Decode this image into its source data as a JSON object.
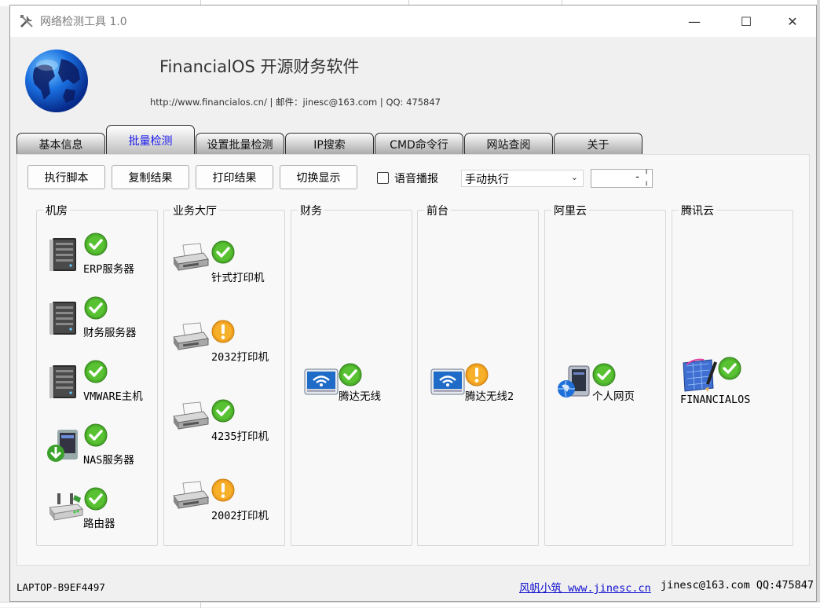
{
  "window": {
    "title": "网络检测工具 1.0",
    "controls": {
      "minimize": "—",
      "maximize": "☐",
      "close": "✕"
    }
  },
  "header": {
    "app_name": "FinancialOS 开源财务软件",
    "contact": "http://www.financialos.cn/ | 邮件：jinesc@163.com | QQ: 475847"
  },
  "tabs": [
    {
      "label": "基本信息",
      "active": false
    },
    {
      "label": "批量检测",
      "active": true
    },
    {
      "label": "设置批量检测",
      "active": false
    },
    {
      "label": "IP搜索",
      "active": false
    },
    {
      "label": "CMD命令行",
      "active": false
    },
    {
      "label": "网站查阅",
      "active": false
    },
    {
      "label": "关于",
      "active": false
    }
  ],
  "toolbar": {
    "run_label": "执行脚本",
    "copy_label": "复制结果",
    "print_label": "打印结果",
    "toggle_label": "切换显示",
    "voice_label": "语音播报",
    "voice_checked": false,
    "mode_value": "手动执行",
    "spin_value": "-"
  },
  "groups": [
    {
      "title": "机房",
      "devices": [
        {
          "label": "ERP服务器",
          "icon": "server-icon",
          "status": "ok"
        },
        {
          "label": "财务服务器",
          "icon": "server-icon",
          "status": "ok"
        },
        {
          "label": "VMWARE主机",
          "icon": "server-icon",
          "status": "ok"
        },
        {
          "label": "NAS服务器",
          "icon": "nas-server-icon",
          "status": "ok"
        },
        {
          "label": "路由器",
          "icon": "router-icon",
          "status": "ok"
        }
      ]
    },
    {
      "title": "业务大厅",
      "devices": [
        {
          "label": "针式打印机",
          "icon": "printer-icon",
          "status": "ok"
        },
        {
          "label": "2032打印机",
          "icon": "printer-icon",
          "status": "warning"
        },
        {
          "label": "4235打印机",
          "icon": "printer-icon",
          "status": "ok"
        },
        {
          "label": "2002打印机",
          "icon": "printer-icon",
          "status": "warning"
        }
      ]
    },
    {
      "title": "财务",
      "devices": [
        {
          "label": "腾达无线",
          "icon": "wifi-router-icon",
          "status": "ok"
        }
      ]
    },
    {
      "title": "前台",
      "devices": [
        {
          "label": "腾达无线2",
          "icon": "wifi-router-icon",
          "status": "warning"
        }
      ]
    },
    {
      "title": "阿里云",
      "devices": [
        {
          "label": "个人网页",
          "icon": "web-server-icon",
          "status": "ok"
        }
      ]
    },
    {
      "title": "腾讯云",
      "devices": [
        {
          "label": "FINANCIALOS",
          "icon": "blueprint-icon",
          "status": "ok"
        }
      ]
    }
  ],
  "statusbar": {
    "host": "LAPTOP-B9EF4497",
    "link": "风帆小筑 www.jinesc.cn",
    "contact": "jinesc@163.com QQ:475847"
  },
  "colors": {
    "ok": "#4caf2a",
    "warning": "#f0a020",
    "active_tab_text": "#1a1aee",
    "link": "#1010d0"
  }
}
